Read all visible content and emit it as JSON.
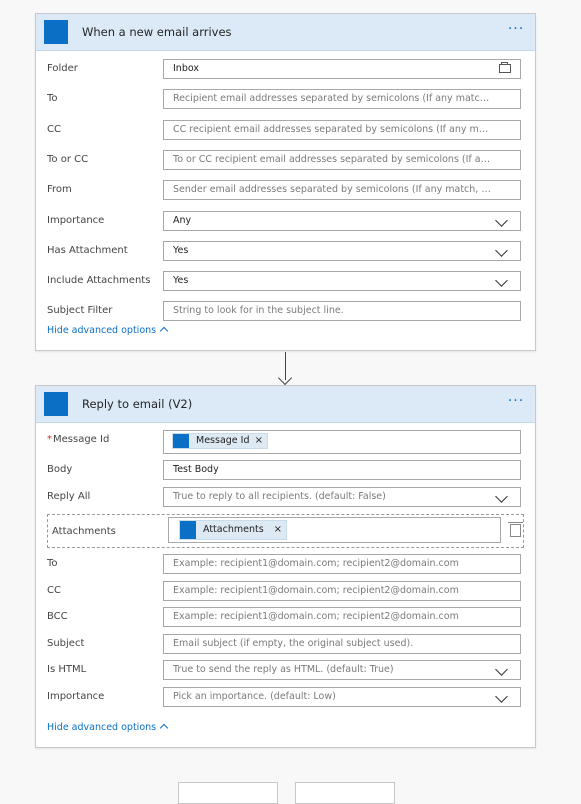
{
  "trigger": {
    "title": "When a new email arrives",
    "icon": "outlook-icon",
    "more": "···",
    "fields": [
      {
        "label": "Folder",
        "value": "Inbox",
        "placeholder": "",
        "type": "folder"
      },
      {
        "label": "To",
        "value": "",
        "placeholder": "Recipient email addresses separated by semicolons (If any match, the trigger will run)",
        "type": "text"
      },
      {
        "label": "CC",
        "value": "",
        "placeholder": "CC recipient email addresses separated by semicolons (If any match, the trigger will run)",
        "type": "text"
      },
      {
        "label": "To or CC",
        "value": "",
        "placeholder": "To or CC recipient email addresses separated by semicolons (If any match, the trigger will run)",
        "type": "text"
      },
      {
        "label": "From",
        "value": "",
        "placeholder": "Sender email addresses separated by semicolons (If any match, the trigger will run)",
        "type": "text"
      },
      {
        "label": "Importance",
        "value": "Any",
        "placeholder": "",
        "type": "dropdown"
      },
      {
        "label": "Has Attachment",
        "value": "Yes",
        "placeholder": "",
        "type": "dropdown"
      },
      {
        "label": "Include Attachments",
        "value": "Yes",
        "placeholder": "",
        "type": "dropdown"
      },
      {
        "label": "Subject Filter",
        "value": "",
        "placeholder": "String to look for in the subject line.",
        "type": "text"
      }
    ],
    "advanced_link": "Hide advanced options"
  },
  "action": {
    "title": "Reply to email (V2)",
    "icon": "outlook-icon",
    "more": "···",
    "message_id": {
      "label": "Message Id",
      "required_mark": "*",
      "token": "Message Id",
      "token_close": "×"
    },
    "body": {
      "label": "Body",
      "value": "Test Body"
    },
    "reply_all": {
      "label": "Reply All",
      "placeholder": "True to reply to all recipients. (default: False)"
    },
    "attachments": {
      "label": "Attachments",
      "token": "Attachments",
      "token_close": "×"
    },
    "fields": [
      {
        "label": "To",
        "placeholder": "Example: recipient1@domain.com; recipient2@domain.com",
        "type": "text"
      },
      {
        "label": "CC",
        "placeholder": "Example: recipient1@domain.com; recipient2@domain.com",
        "type": "text"
      },
      {
        "label": "BCC",
        "placeholder": "Example: recipient1@domain.com; recipient2@domain.com",
        "type": "text"
      },
      {
        "label": "Subject",
        "placeholder": "Email subject (if empty, the original subject used).",
        "type": "text"
      },
      {
        "label": "Is HTML",
        "placeholder": "True to send the reply as HTML. (default: True)",
        "type": "dropdown"
      },
      {
        "label": "Importance",
        "placeholder": "Pick an importance. (default: Low)",
        "type": "dropdown"
      }
    ],
    "advanced_link": "Hide advanced options"
  },
  "colors": {
    "accent": "#0b6fc6",
    "header_bg": "#dbeaf6",
    "token_bg": "#dde9f3"
  }
}
